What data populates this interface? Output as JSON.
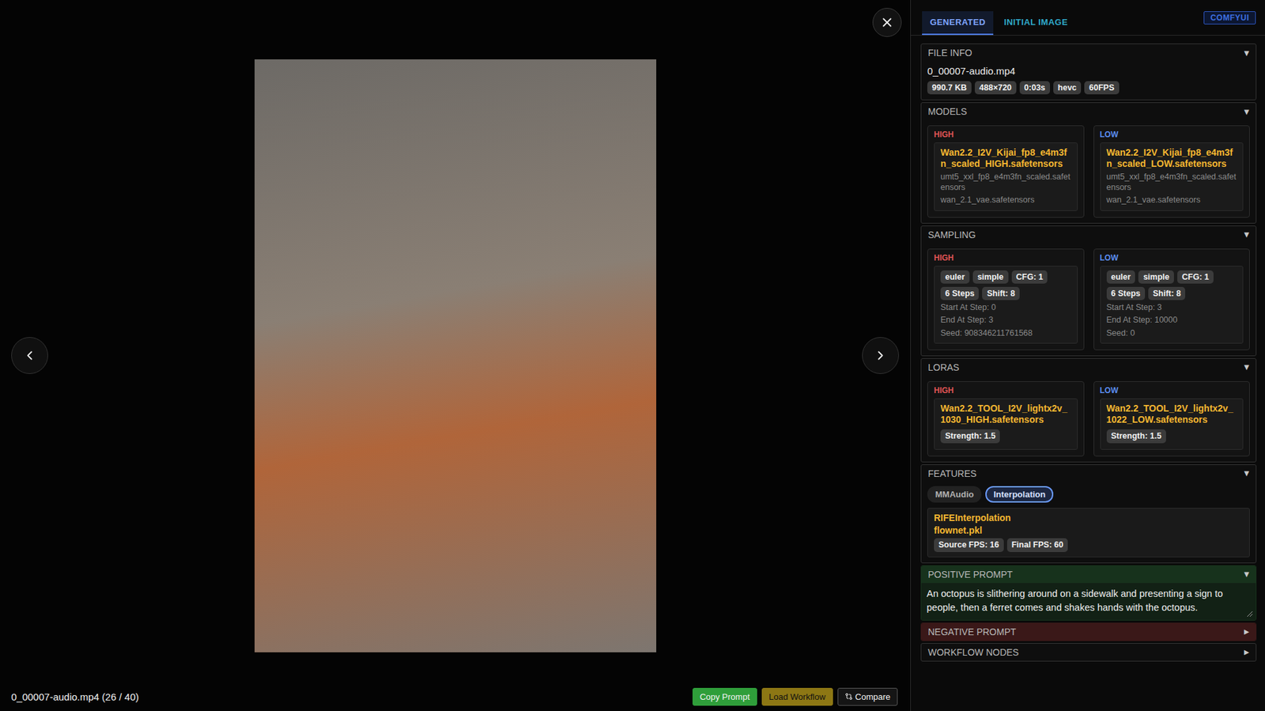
{
  "viewer": {
    "caption": "0_00007-audio.mp4 (26 / 40)",
    "buttons": [
      {
        "label": "Copy Prompt",
        "color": "#2f9e3a",
        "kind": "primary"
      },
      {
        "label": "Load Workflow",
        "color": "#8d7714",
        "kind": "accent"
      },
      {
        "label": "Compare",
        "color": "#151515",
        "kind": "outline"
      }
    ]
  },
  "sidebar": {
    "tabs": [
      {
        "label": "GENERATED",
        "selected": true
      },
      {
        "label": "INITIAL IMAGE",
        "selected": false
      }
    ],
    "badge": "COMFYUI",
    "sections": [
      {
        "kind": "file",
        "title": "FILE INFO",
        "toggle": "▼",
        "expanded": true,
        "name": "0_00007-audio.mp4",
        "chips": [
          "990.7 KB",
          "488×720",
          "0:03s",
          "hevc",
          "60FPS"
        ]
      },
      {
        "kind": "columns",
        "title": "MODELS",
        "toggle": "▼",
        "expanded": true,
        "columns": [
          {
            "label": "HIGH",
            "color": "#e05555",
            "name": "Wan2.2_I2V_Kijai_fp8_e4m3fn_scaled_HIGH.safetensors",
            "chips": [],
            "lines": [
              "umt5_xxl_fp8_e4m3fn_scaled.safetensors",
              "wan_2.1_vae.safetensors"
            ]
          },
          {
            "label": "LOW",
            "color": "#5b8def",
            "name": "Wan2.2_I2V_Kijai_fp8_e4m3fn_scaled_LOW.safetensors",
            "chips": [],
            "lines": [
              "umt5_xxl_fp8_e4m3fn_scaled.safetensors",
              "wan_2.1_vae.safetensors"
            ]
          }
        ]
      },
      {
        "kind": "columns",
        "title": "SAMPLING",
        "toggle": "▼",
        "expanded": true,
        "columns": [
          {
            "label": "HIGH",
            "color": "#e05555",
            "name": "",
            "chips": [
              "euler",
              "simple",
              "CFG: 1",
              "6 Steps",
              "Shift: 8"
            ],
            "lines": [
              "Start At Step: 0",
              "End At Step: 3",
              "Seed: 908346211761568"
            ]
          },
          {
            "label": "LOW",
            "color": "#5b8def",
            "name": "",
            "chips": [
              "euler",
              "simple",
              "CFG: 1",
              "6 Steps",
              "Shift: 8"
            ],
            "lines": [
              "Start At Step: 3",
              "End At Step: 10000",
              "Seed: 0"
            ]
          }
        ]
      },
      {
        "kind": "columns",
        "title": "LORAS",
        "toggle": "▼",
        "expanded": true,
        "columns": [
          {
            "label": "HIGH",
            "color": "#e05555",
            "name": "Wan2.2_TOOL_I2V_lightx2v_1030_HIGH.safetensors",
            "chips": [
              "Strength: 1.5"
            ],
            "lines": []
          },
          {
            "label": "LOW",
            "color": "#5b8def",
            "name": "Wan2.2_TOOL_I2V_lightx2v_1022_LOW.safetensors",
            "chips": [
              "Strength: 1.5"
            ],
            "lines": []
          }
        ]
      },
      {
        "kind": "features",
        "title": "FEATURES",
        "toggle": "▼",
        "expanded": true,
        "toggles": [
          {
            "label": "MMAudio",
            "selected": false
          },
          {
            "label": "Interpolation",
            "selected": true
          }
        ],
        "card": {
          "lines": [
            "RIFEInterpolation",
            "flownet.pkl"
          ],
          "chips": [
            "Source FPS: 16",
            "Final FPS: 60"
          ]
        }
      },
      {
        "kind": "prompt",
        "title": "POSITIVE PROMPT",
        "toggle": "▼",
        "expanded": true,
        "color": "#17321c",
        "text": "An octopus is slithering around on a sidewalk and presenting a sign to people, then a ferret comes and shakes hands with the octopus."
      },
      {
        "kind": "prompt",
        "title": "NEGATIVE PROMPT",
        "toggle": "▶",
        "expanded": false,
        "color": "#3a1818",
        "text": ""
      },
      {
        "kind": "plain",
        "title": "WORKFLOW NODES",
        "toggle": "▶",
        "expanded": false
      }
    ]
  }
}
